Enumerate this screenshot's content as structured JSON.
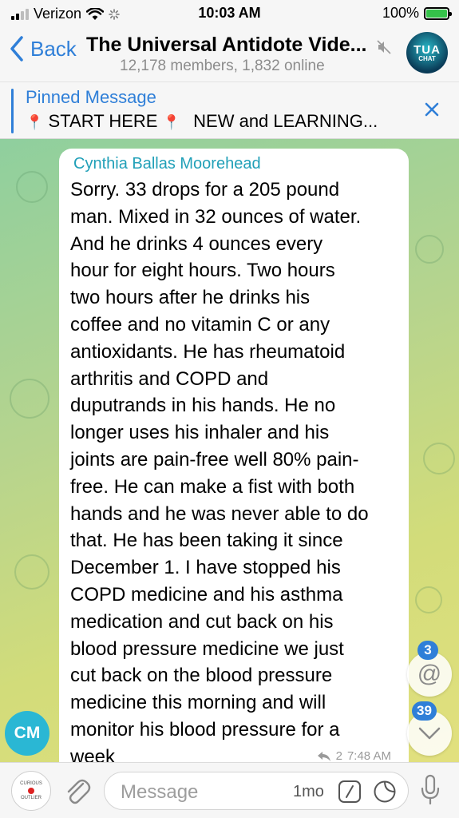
{
  "status_bar": {
    "carrier": "Verizon",
    "time": "10:03 AM",
    "battery": "100%"
  },
  "header": {
    "back_label": "Back",
    "title": "The Universal Antidote Vide...",
    "subtitle": "12,178 members, 1,832 online",
    "avatar_text_top": "TUA",
    "avatar_text_bottom": "CHAT"
  },
  "pinned": {
    "label": "Pinned Message",
    "text_part1": "START HERE",
    "text_part2": "NEW and LEARNING..."
  },
  "message": {
    "sender": "Cynthia Ballas Moorehead",
    "lines": [
      "Sorry.  33 drops for a 205 pound",
      "man. Mixed in 32 ounces of water.",
      "And he drinks 4 ounces every",
      "hour for eight hours. Two hours",
      "two hours after he drinks his",
      "coffee and no vitamin C or any",
      "antioxidants.  He has rheumatoid",
      "arthritis and COPD and",
      "duputrands in his hands. He no",
      "longer uses his inhaler and his",
      "joints are pain-free well 80% pain-",
      "free. He can make a fist with both",
      "hands and he was never able to do",
      "that. He has been taking it since",
      "December 1. I have stopped his",
      "COPD medicine and his asthma",
      "medication and cut back on his",
      "blood pressure medicine we just",
      "cut back on the blood pressure",
      "medicine this morning and will",
      "monitor his blood pressure for a",
      "week"
    ],
    "reply_count": "2",
    "time": "7:48 AM",
    "avatar_initials": "CM"
  },
  "badges": {
    "mentions": "3",
    "unread": "39"
  },
  "input": {
    "placeholder": "Message",
    "timer": "1mo",
    "avatar_top": "CURIOUS",
    "avatar_bottom": "OUTLIER"
  }
}
